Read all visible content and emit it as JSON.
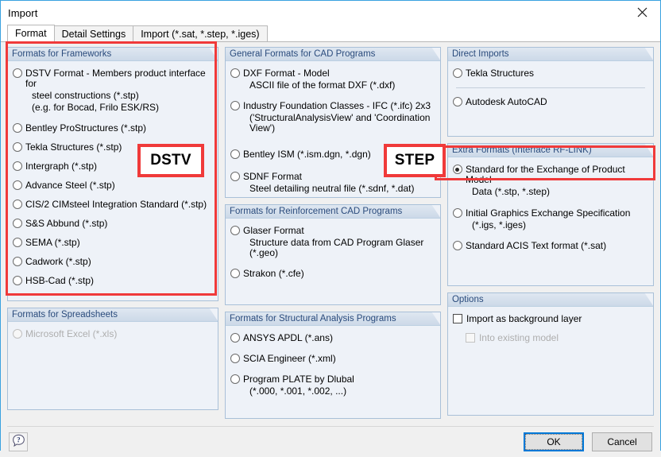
{
  "window": {
    "title": "Import",
    "close_icon": "close-icon"
  },
  "tabs": [
    {
      "label": "Format",
      "active": true
    },
    {
      "label": "Detail Settings",
      "active": false
    },
    {
      "label": "Import (*.sat, *.step, *.iges)",
      "active": false
    }
  ],
  "groups": {
    "frameworks": {
      "title": "Formats for Frameworks",
      "options": [
        {
          "line1": "DSTV Format - Members product interface for",
          "line2": "steel constructions (*.stp)",
          "line3": "(e.g. for Bocad, Frilo ESK/RS)",
          "checked": false,
          "disabled": false
        },
        {
          "line1": "Bentley ProStructures (*.stp)",
          "checked": false,
          "disabled": false
        },
        {
          "line1": "Tekla Structures (*.stp)",
          "checked": false,
          "disabled": false
        },
        {
          "line1": "Intergraph (*.stp)",
          "checked": false,
          "disabled": false
        },
        {
          "line1": "Advance Steel (*.stp)",
          "checked": false,
          "disabled": false
        },
        {
          "line1": "CIS/2 CIMsteel Integration Standard (*.stp)",
          "checked": false,
          "disabled": false
        },
        {
          "line1": "S&S Abbund (*.stp)",
          "checked": false,
          "disabled": false
        },
        {
          "line1": "SEMA (*.stp)",
          "checked": false,
          "disabled": false
        },
        {
          "line1": "Cadwork (*.stp)",
          "checked": false,
          "disabled": false
        },
        {
          "line1": "HSB-Cad (*.stp)",
          "checked": false,
          "disabled": false
        }
      ]
    },
    "spreadsheets": {
      "title": "Formats for Spreadsheets",
      "options": [
        {
          "line1": "Microsoft Excel (*.xls)",
          "checked": false,
          "disabled": true
        }
      ]
    },
    "cad": {
      "title": "General Formats for CAD Programs",
      "options": [
        {
          "line1": "DXF Format - Model",
          "line2": "ASCII file of the format DXF (*.dxf)",
          "checked": false,
          "disabled": false
        },
        {
          "line1": "Industry Foundation Classes - IFC (*.ifc) 2x3",
          "line2": "('StructuralAnalysisView' and 'Coordination View')",
          "checked": false,
          "disabled": false
        },
        {
          "line1": "Bentley ISM (*.ism.dgn, *.dgn)",
          "checked": false,
          "disabled": false
        },
        {
          "line1": "SDNF Format",
          "line2": "Steel detailing neutral file (*.sdnf, *.dat)",
          "checked": false,
          "disabled": false
        }
      ]
    },
    "reinforcement": {
      "title": "Formats for Reinforcement CAD Programs",
      "options": [
        {
          "line1": "Glaser Format",
          "line2": "Structure data from CAD Program Glaser (*.geo)",
          "checked": false,
          "disabled": false
        },
        {
          "line1": "Strakon (*.cfe)",
          "checked": false,
          "disabled": false
        }
      ]
    },
    "structural": {
      "title": "Formats for Structural Analysis Programs",
      "options": [
        {
          "line1": "ANSYS APDL (*.ans)",
          "checked": false,
          "disabled": false
        },
        {
          "line1": "SCIA Engineer (*.xml)",
          "checked": false,
          "disabled": false
        },
        {
          "line1": "Program PLATE by Dlubal",
          "line2": "(*.000, *.001, *.002, ...)",
          "checked": false,
          "disabled": false
        }
      ]
    },
    "direct": {
      "title": "Direct Imports",
      "options": [
        {
          "line1": "Tekla Structures",
          "checked": false,
          "disabled": false
        },
        {
          "line1": "Autodesk AutoCAD",
          "checked": false,
          "disabled": false
        }
      ]
    },
    "extra": {
      "title": "Extra Formats (Interface RF-LINK)",
      "options": [
        {
          "line1": "Standard for the Exchange of Product Model",
          "line2": "Data (*.stp, *.step)",
          "checked": true,
          "disabled": false
        },
        {
          "line1": "Initial Graphics Exchange Specification",
          "line2": "(*.igs, *.iges)",
          "checked": false,
          "disabled": false
        },
        {
          "line1": "Standard ACIS Text format (*.sat)",
          "checked": false,
          "disabled": false
        }
      ]
    },
    "options": {
      "title": "Options",
      "items": [
        {
          "label": "Import as background layer",
          "checked": false,
          "disabled": false
        },
        {
          "label": "Into existing model",
          "checked": false,
          "disabled": true
        }
      ]
    }
  },
  "annotations": [
    {
      "name": "dstv-tag",
      "text": "DSTV"
    },
    {
      "name": "step-tag",
      "text": "STEP"
    }
  ],
  "footer": {
    "help_icon": "help-icon",
    "ok_label": "OK",
    "cancel_label": "Cancel"
  },
  "colors": {
    "annotation_red": "#f03a3a",
    "window_border": "#3aa2e0",
    "group_title": "#2a4b7c",
    "focus_blue": "#0078d7"
  }
}
